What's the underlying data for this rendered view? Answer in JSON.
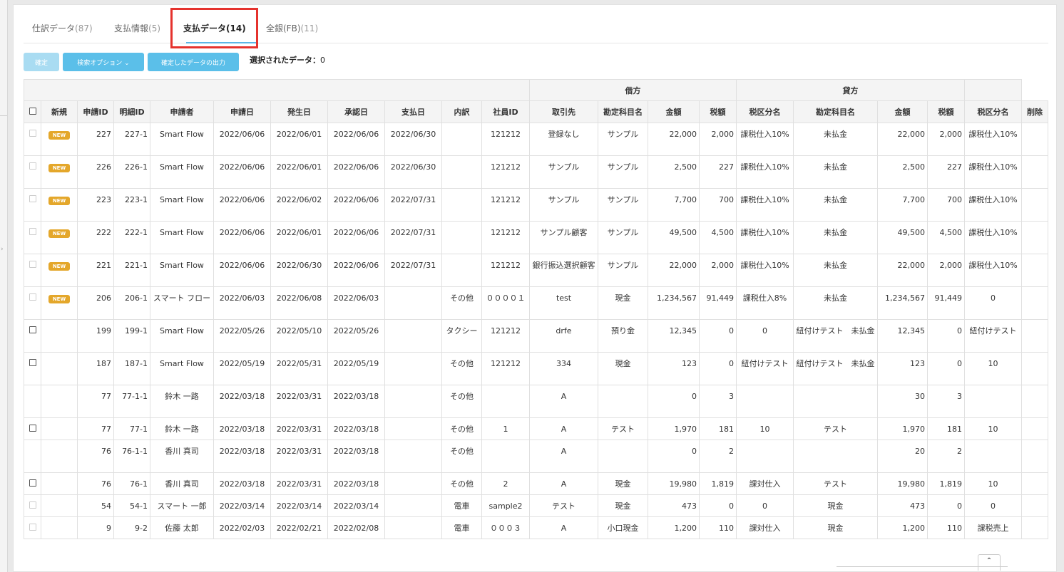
{
  "tabs": [
    {
      "label": "仕訳データ",
      "count": "(87)"
    },
    {
      "label": "支払情報",
      "count": "(5)"
    },
    {
      "label": "支払データ",
      "count": "(14)"
    },
    {
      "label": "全銀(FB)",
      "count": "(11)"
    }
  ],
  "active_tab": 2,
  "toolbar": {
    "confirm_label": "確定",
    "search_options_label": "検索オプション ⌄",
    "export_label": "確定したデータの出力",
    "selected_label": "選択されたデータ：",
    "selected_count": "0"
  },
  "table": {
    "group_debit": "借方",
    "group_credit": "貸方",
    "columns": [
      "新規",
      "申請ID",
      "明細ID",
      "申請者",
      "申請日",
      "発生日",
      "承認日",
      "支払日",
      "内訳",
      "社員ID",
      "取引先",
      "勘定科目名",
      "金額",
      "税額",
      "税区分名",
      "勘定科目名",
      "金額",
      "税額",
      "税区分名",
      "削除"
    ],
    "new_badge": "NEW",
    "rows": [
      {
        "cb": "disabled",
        "isnew": true,
        "apply_id": "227",
        "detail_id": "227-1",
        "applicant": "Smart Flow",
        "applied": "2022/06/06",
        "occurred": "2022/06/01",
        "approved": "2022/06/06",
        "paid": "2022/06/30",
        "breakdown": "",
        "employee": "121212",
        "partner": "登録なし",
        "d_account": "サンプル",
        "d_amount": "22,000",
        "d_tax": "2,000",
        "d_taxclass": "課税仕入10%",
        "c_account": "未払金",
        "c_amount": "22,000",
        "c_tax": "2,000",
        "c_taxclass": "課税仕入10%"
      },
      {
        "cb": "disabled",
        "isnew": true,
        "apply_id": "226",
        "detail_id": "226-1",
        "applicant": "Smart Flow",
        "applied": "2022/06/06",
        "occurred": "2022/06/01",
        "approved": "2022/06/06",
        "paid": "2022/06/30",
        "breakdown": "",
        "employee": "121212",
        "partner": "サンプル",
        "d_account": "サンプル",
        "d_amount": "2,500",
        "d_tax": "227",
        "d_taxclass": "課税仕入10%",
        "c_account": "未払金",
        "c_amount": "2,500",
        "c_tax": "227",
        "c_taxclass": "課税仕入10%"
      },
      {
        "cb": "disabled",
        "isnew": true,
        "apply_id": "223",
        "detail_id": "223-1",
        "applicant": "Smart Flow",
        "applied": "2022/06/06",
        "occurred": "2022/06/02",
        "approved": "2022/06/06",
        "paid": "2022/07/31",
        "breakdown": "",
        "employee": "121212",
        "partner": "サンプル",
        "d_account": "サンプル",
        "d_amount": "7,700",
        "d_tax": "700",
        "d_taxclass": "課税仕入10%",
        "c_account": "未払金",
        "c_amount": "7,700",
        "c_tax": "700",
        "c_taxclass": "課税仕入10%"
      },
      {
        "cb": "disabled",
        "isnew": true,
        "apply_id": "222",
        "detail_id": "222-1",
        "applicant": "Smart Flow",
        "applied": "2022/06/06",
        "occurred": "2022/06/01",
        "approved": "2022/06/06",
        "paid": "2022/07/31",
        "breakdown": "",
        "employee": "121212",
        "partner": "サンプル顧客",
        "d_account": "サンプル",
        "d_amount": "49,500",
        "d_tax": "4,500",
        "d_taxclass": "課税仕入10%",
        "c_account": "未払金",
        "c_amount": "49,500",
        "c_tax": "4,500",
        "c_taxclass": "課税仕入10%"
      },
      {
        "cb": "disabled",
        "isnew": true,
        "apply_id": "221",
        "detail_id": "221-1",
        "applicant": "Smart Flow",
        "applied": "2022/06/06",
        "occurred": "2022/06/30",
        "approved": "2022/06/06",
        "paid": "2022/07/31",
        "breakdown": "",
        "employee": "121212",
        "partner": "銀行振込選択顧客",
        "d_account": "サンプル",
        "d_amount": "22,000",
        "d_tax": "2,000",
        "d_taxclass": "課税仕入10%",
        "c_account": "未払金",
        "c_amount": "22,000",
        "c_tax": "2,000",
        "c_taxclass": "課税仕入10%"
      },
      {
        "cb": "disabled",
        "isnew": true,
        "apply_id": "206",
        "detail_id": "206-1",
        "applicant": "スマート フロー",
        "applied": "2022/06/03",
        "occurred": "2022/06/08",
        "approved": "2022/06/03",
        "paid": "",
        "breakdown": "その他",
        "employee": "００００１",
        "partner": "test",
        "d_account": "現金",
        "d_amount": "1,234,567",
        "d_tax": "91,449",
        "d_taxclass": "課税仕入8%",
        "c_account": "未払金",
        "c_amount": "1,234,567",
        "c_tax": "91,449",
        "c_taxclass": "0"
      },
      {
        "cb": "enabled",
        "isnew": false,
        "apply_id": "199",
        "detail_id": "199-1",
        "applicant": "Smart Flow",
        "applied": "2022/05/26",
        "occurred": "2022/05/10",
        "approved": "2022/05/26",
        "paid": "",
        "breakdown": "タクシー",
        "employee": "121212",
        "partner": "drfe",
        "d_account": "預り金",
        "d_amount": "12,345",
        "d_tax": "0",
        "d_taxclass": "0",
        "c_account": "紐付けテスト　未払金",
        "c_amount": "12,345",
        "c_tax": "0",
        "c_taxclass": "紐付けテスト"
      },
      {
        "cb": "enabled",
        "isnew": false,
        "apply_id": "187",
        "detail_id": "187-1",
        "applicant": "Smart Flow",
        "applied": "2022/05/19",
        "occurred": "2022/05/31",
        "approved": "2022/05/19",
        "paid": "",
        "breakdown": "その他",
        "employee": "121212",
        "partner": "334",
        "d_account": "現金",
        "d_amount": "123",
        "d_tax": "0",
        "d_taxclass": "紐付けテスト",
        "c_account": "紐付けテスト　未払金",
        "c_amount": "123",
        "c_tax": "0",
        "c_taxclass": "10"
      },
      {
        "cb": "none",
        "isnew": false,
        "apply_id": "77",
        "detail_id": "77-1-1",
        "applicant": "鈴木 一路",
        "applied": "2022/03/18",
        "occurred": "2022/03/31",
        "approved": "2022/03/18",
        "paid": "",
        "breakdown": "その他",
        "employee": "",
        "partner": "A",
        "d_account": "",
        "d_amount": "0",
        "d_tax": "3",
        "d_taxclass": "",
        "c_account": "",
        "c_amount": "30",
        "c_tax": "3",
        "c_taxclass": ""
      },
      {
        "cb": "enabled",
        "isnew": false,
        "apply_id": "77",
        "detail_id": "77-1",
        "applicant": "鈴木 一路",
        "applied": "2022/03/18",
        "occurred": "2022/03/31",
        "approved": "2022/03/18",
        "paid": "",
        "breakdown": "その他",
        "employee": "1",
        "partner": "A",
        "d_account": "テスト",
        "d_amount": "1,970",
        "d_tax": "181",
        "d_taxclass": "10",
        "c_account": "テスト",
        "c_amount": "1,970",
        "c_tax": "181",
        "c_taxclass": "10"
      },
      {
        "cb": "none",
        "isnew": false,
        "apply_id": "76",
        "detail_id": "76-1-1",
        "applicant": "香川 真司",
        "applied": "2022/03/18",
        "occurred": "2022/03/31",
        "approved": "2022/03/18",
        "paid": "",
        "breakdown": "その他",
        "employee": "",
        "partner": "A",
        "d_account": "",
        "d_amount": "0",
        "d_tax": "2",
        "d_taxclass": "",
        "c_account": "",
        "c_amount": "20",
        "c_tax": "2",
        "c_taxclass": ""
      },
      {
        "cb": "enabled",
        "isnew": false,
        "apply_id": "76",
        "detail_id": "76-1",
        "applicant": "香川 真司",
        "applied": "2022/03/18",
        "occurred": "2022/03/31",
        "approved": "2022/03/18",
        "paid": "",
        "breakdown": "その他",
        "employee": "2",
        "partner": "A",
        "d_account": "現金",
        "d_amount": "19,980",
        "d_tax": "1,819",
        "d_taxclass": "課対仕入",
        "c_account": "テスト",
        "c_amount": "19,980",
        "c_tax": "1,819",
        "c_taxclass": "10"
      },
      {
        "cb": "disabled",
        "isnew": false,
        "apply_id": "54",
        "detail_id": "54-1",
        "applicant": "スマート 一郎",
        "applied": "2022/03/14",
        "occurred": "2022/03/14",
        "approved": "2022/03/14",
        "paid": "",
        "breakdown": "電車",
        "employee": "sample2",
        "partner": "テスト",
        "d_account": "現金",
        "d_amount": "473",
        "d_tax": "0",
        "d_taxclass": "0",
        "c_account": "現金",
        "c_amount": "473",
        "c_tax": "0",
        "c_taxclass": "0"
      },
      {
        "cb": "disabled",
        "isnew": false,
        "apply_id": "9",
        "detail_id": "9-2",
        "applicant": "佐藤 太郎",
        "applied": "2022/02/03",
        "occurred": "2022/02/21",
        "approved": "2022/02/08",
        "paid": "",
        "breakdown": "電車",
        "employee": "０００３",
        "partner": "A",
        "d_account": "小口現金",
        "d_amount": "1,200",
        "d_tax": "110",
        "d_taxclass": "課対仕入",
        "c_account": "現金",
        "c_amount": "1,200",
        "c_tax": "110",
        "c_taxclass": "課税売上"
      }
    ]
  },
  "scroll_top_icon": "chevron-up-icon"
}
